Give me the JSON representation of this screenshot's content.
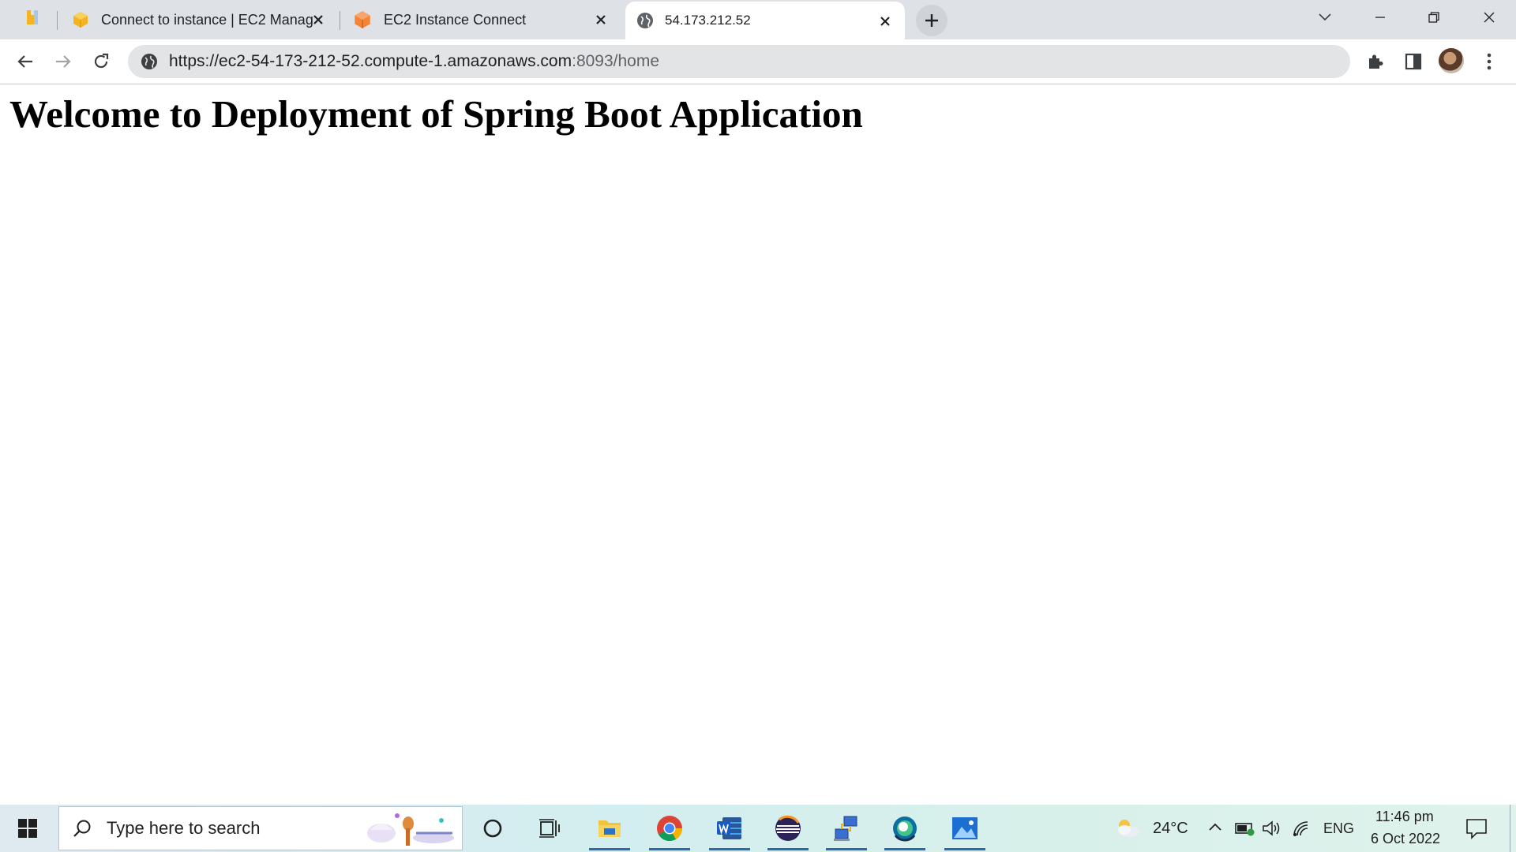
{
  "browser": {
    "tabs": [
      {
        "label": "",
        "icon": "bookmark-icon"
      },
      {
        "label": "Connect to instance | EC2 Manag",
        "icon": "aws-cube-icon"
      },
      {
        "label": "EC2 Instance Connect",
        "icon": "aws-cube-icon"
      },
      {
        "label": "54.173.212.52",
        "icon": "globe-icon",
        "active": true
      }
    ],
    "address_bar": {
      "url_main": "https://ec2-54-173-212-52.compute-1.amazonaws.com",
      "url_rest": ":8093/home"
    }
  },
  "page": {
    "heading": "Welcome to Deployment of Spring Boot Application"
  },
  "taskbar": {
    "search_placeholder": "Type here to search",
    "weather": "24°C",
    "language": "ENG",
    "time": "11:46 pm",
    "date": "6 Oct 2022"
  },
  "colors": {
    "tabstrip_bg": "#dee1e6",
    "omnibox_bg": "#e3e4e6",
    "aws_orange": "#f58536",
    "aws_yellow": "#f5b324",
    "taskbar_accent": "#2b6cb0"
  }
}
